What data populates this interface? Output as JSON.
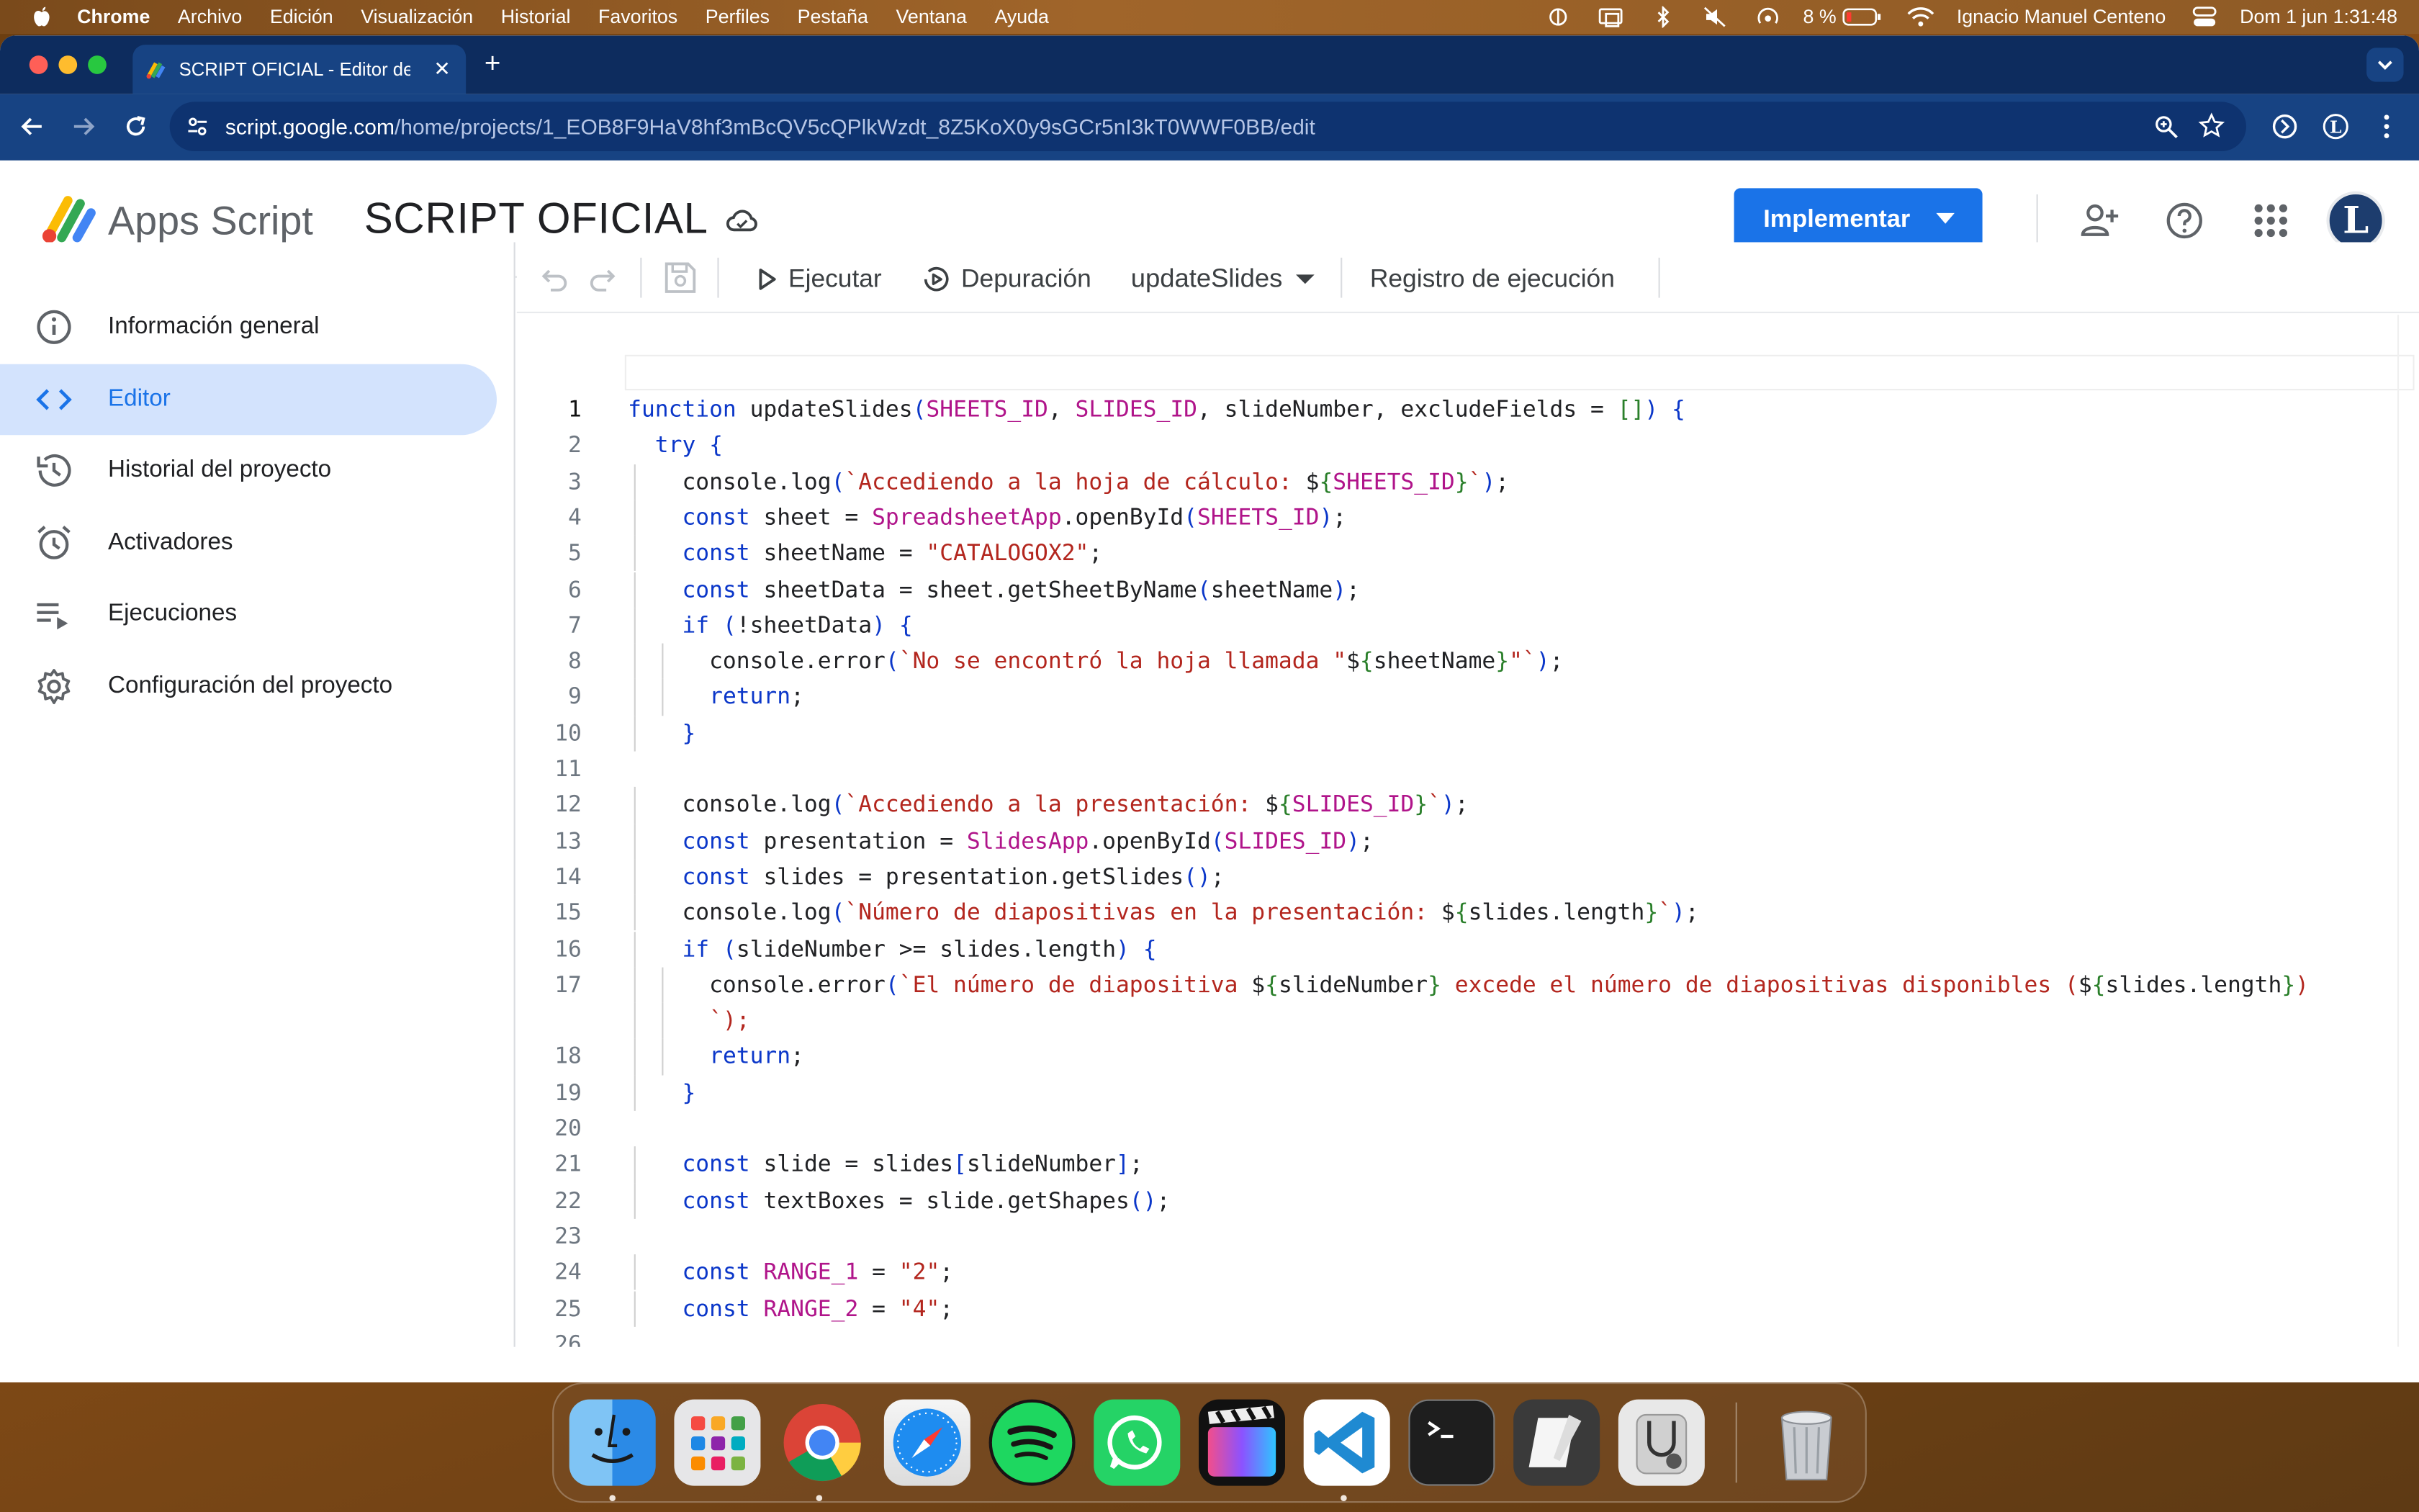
{
  "menubar": {
    "app": "Chrome",
    "items": [
      "Archivo",
      "Edición",
      "Visualización",
      "Historial",
      "Favoritos",
      "Perfiles",
      "Pestaña",
      "Ventana",
      "Ayuda"
    ],
    "battery": "8 %",
    "user": "Ignacio Manuel Centeno",
    "datetime": "Dom 1 jun  1:31:48"
  },
  "browser": {
    "tab_title": "SCRIPT OFICIAL - Editor del p",
    "url_host": "script.google.com",
    "url_path": "/home/projects/1_EOB8F9HaV8hf3mBcQV5cQPlkWzdt_8Z5KoX0y9sGCr5nI3kT0WWF0BB/edit"
  },
  "header": {
    "product": "Apps Script",
    "project_title": "SCRIPT OFICIAL",
    "deploy_label": "Implementar",
    "avatar_letter": "L"
  },
  "sidebar": {
    "items": [
      {
        "label": "Información general",
        "icon": "info-icon"
      },
      {
        "label": "Editor",
        "icon": "code-icon"
      },
      {
        "label": "Historial del proyecto",
        "icon": "history-icon"
      },
      {
        "label": "Activadores",
        "icon": "alarm-icon"
      },
      {
        "label": "Ejecuciones",
        "icon": "executions-list-icon"
      },
      {
        "label": "Configuración del proyecto",
        "icon": "gear-icon"
      }
    ]
  },
  "editor_toolbar": {
    "run_label": "Ejecutar",
    "debug_label": "Depuración",
    "function_select": "updateSlides",
    "log_label": "Registro de ejecución"
  },
  "colors": {
    "accent": "#1a73e8",
    "active_nav": "#d3e3fd",
    "keyword": "#0b37c9",
    "string": "#b3261e",
    "global_identifier": "#b0148a"
  },
  "code": {
    "current_line": 1,
    "lines": [
      {
        "n": "1",
        "text": "function updateSlides(SHEETS_ID, SLIDES_ID, slideNumber, excludeFields = []) {"
      },
      {
        "n": "2",
        "text": "  try {"
      },
      {
        "n": "3",
        "text": "    console.log(`Accediendo a la hoja de cálculo: ${SHEETS_ID}`);"
      },
      {
        "n": "4",
        "text": "    const sheet = SpreadsheetApp.openById(SHEETS_ID);"
      },
      {
        "n": "5",
        "text": "    const sheetName = \"CATALOGOX2\";"
      },
      {
        "n": "6",
        "text": "    const sheetData = sheet.getSheetByName(sheetName);"
      },
      {
        "n": "7",
        "text": "    if (!sheetData) {"
      },
      {
        "n": "8",
        "text": "      console.error(`No se encontró la hoja llamada \"${sheetName}\"`);"
      },
      {
        "n": "9",
        "text": "      return;"
      },
      {
        "n": "10",
        "text": "    }"
      },
      {
        "n": "11",
        "text": ""
      },
      {
        "n": "12",
        "text": "    console.log(`Accediendo a la presentación: ${SLIDES_ID}`);"
      },
      {
        "n": "13",
        "text": "    const presentation = SlidesApp.openById(SLIDES_ID);"
      },
      {
        "n": "14",
        "text": "    const slides = presentation.getSlides();"
      },
      {
        "n": "15",
        "text": "    console.log(`Número de diapositivas en la presentación: ${slides.length}`);"
      },
      {
        "n": "16",
        "text": "    if (slideNumber >= slides.length) {"
      },
      {
        "n": "17",
        "text": "      console.error(`El número de diapositiva ${slideNumber} excede el número de diapositivas disponibles (${slides.length})"
      },
      {
        "n": "",
        "text": "      `);"
      },
      {
        "n": "18",
        "text": "      return;"
      },
      {
        "n": "19",
        "text": "    }"
      },
      {
        "n": "20",
        "text": ""
      },
      {
        "n": "21",
        "text": "    const slide = slides[slideNumber];"
      },
      {
        "n": "22",
        "text": "    const textBoxes = slide.getShapes();"
      },
      {
        "n": "23",
        "text": ""
      },
      {
        "n": "24",
        "text": "    const RANGE_1 = \"2\";"
      },
      {
        "n": "25",
        "text": "    const RANGE_2 = \"4\";"
      },
      {
        "n": "26",
        "text": ""
      },
      {
        "n": "27",
        "text": "    const dataMapping = {"
      }
    ]
  },
  "dock": {
    "apps": [
      "Finder",
      "Launchpad",
      "Google Chrome",
      "Safari",
      "Spotify",
      "WhatsApp",
      "Final Cut Pro",
      "Visual Studio Code",
      "Terminal",
      "Pages",
      "Utilidad de Discos",
      "Papelera"
    ]
  }
}
